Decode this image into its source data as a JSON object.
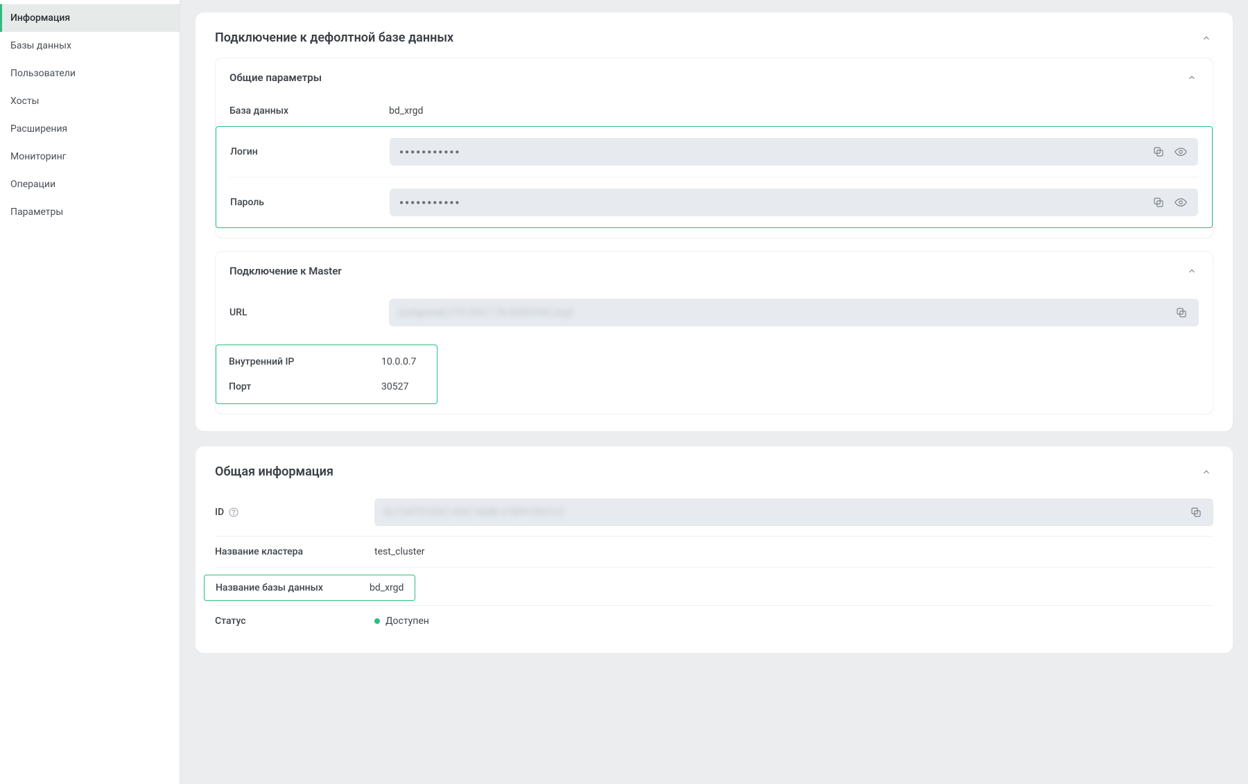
{
  "sidebar": {
    "items": [
      {
        "label": "Информация",
        "name": "sidebar-item-info",
        "active": true
      },
      {
        "label": "Базы данных",
        "name": "sidebar-item-databases",
        "active": false
      },
      {
        "label": "Пользователи",
        "name": "sidebar-item-users",
        "active": false
      },
      {
        "label": "Хосты",
        "name": "sidebar-item-hosts",
        "active": false
      },
      {
        "label": "Расширения",
        "name": "sidebar-item-extensions",
        "active": false
      },
      {
        "label": "Мониторинг",
        "name": "sidebar-item-monitoring",
        "active": false
      },
      {
        "label": "Операции",
        "name": "sidebar-item-operations",
        "active": false
      },
      {
        "label": "Параметры",
        "name": "sidebar-item-parameters",
        "active": false
      }
    ]
  },
  "connection_card": {
    "title": "Подключение к дефолтной базе данных",
    "general": {
      "title": "Общие параметры",
      "database_label": "База данных",
      "database_value": "bd_xrgd",
      "login_label": "Логин",
      "login_masked": "●●●●●●●●●●●",
      "password_label": "Пароль",
      "password_masked": "●●●●●●●●●●●"
    },
    "master": {
      "title": "Подключение к Master",
      "url_label": "URL",
      "url_masked_placeholder": "postgresql://10.254.7.78:32065/bd_xrgd",
      "ip_label": "Внутренний IP",
      "ip_value": "10.0.0.7",
      "port_label": "Порт",
      "port_value": "30527"
    }
  },
  "info_card": {
    "title": "Общая информация",
    "id_label": "ID",
    "id_masked_placeholder": "8c77af70-6267-4361-8e86-a18f4126d1c3",
    "cluster_label": "Название кластера",
    "cluster_value": "test_cluster",
    "dbname_label": "Название базы данных",
    "dbname_value": "bd_xrgd",
    "status_label": "Статус",
    "status_value": "Доступен"
  },
  "icons": {
    "copy": "copy-icon",
    "eye": "eye-icon",
    "chevron_up": "chevron-up-icon",
    "help": "help-icon"
  }
}
